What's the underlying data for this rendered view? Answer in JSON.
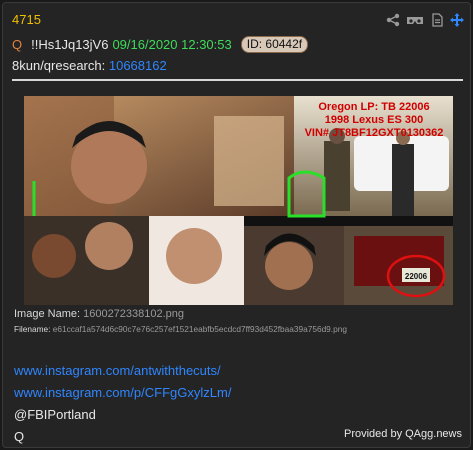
{
  "post": {
    "number": "4715",
    "q_marker": "Q",
    "tripcode": "!!Hs1Jq13jV6",
    "datetime": "09/16/2020 12:30:53",
    "id_badge": "ID: 60442f",
    "board_label": "8kun/qresearch:",
    "board_post_link": "10668162"
  },
  "toolbar": {
    "icons": [
      "share-icon",
      "vr-glasses-icon",
      "document-icon",
      "move-arrows-icon"
    ]
  },
  "image": {
    "overlay_line1": "Oregon LP: TB 22006",
    "overlay_line2": "1998 Lexus ES 300",
    "overlay_line3": "VIN# JT8BF12GXT0130362",
    "plate_text": "22006",
    "name_label": "Image Name:",
    "name_value": "1600272338102.png",
    "filename_label": "Filename:",
    "filename_value": "e61ccaf1a574d6c90c7e76c257ef1521eabfb5ecdcd7ff93d452fbaa39a756d9.png"
  },
  "body": {
    "link1": "www.instagram.com/antwiththecuts/",
    "link2": "www.instagram.com/p/CFFgGxylzLm/",
    "line3": "@FBIPortland",
    "line4": "Q"
  },
  "footer": {
    "credit": "Provided by QAgg.news"
  },
  "colors": {
    "background": "#242424",
    "post_number": "#f0c000",
    "datetime": "#3ddc5a",
    "link": "#2f86ff",
    "overlay_text": "#d00000",
    "q_marker": "#e08040"
  }
}
